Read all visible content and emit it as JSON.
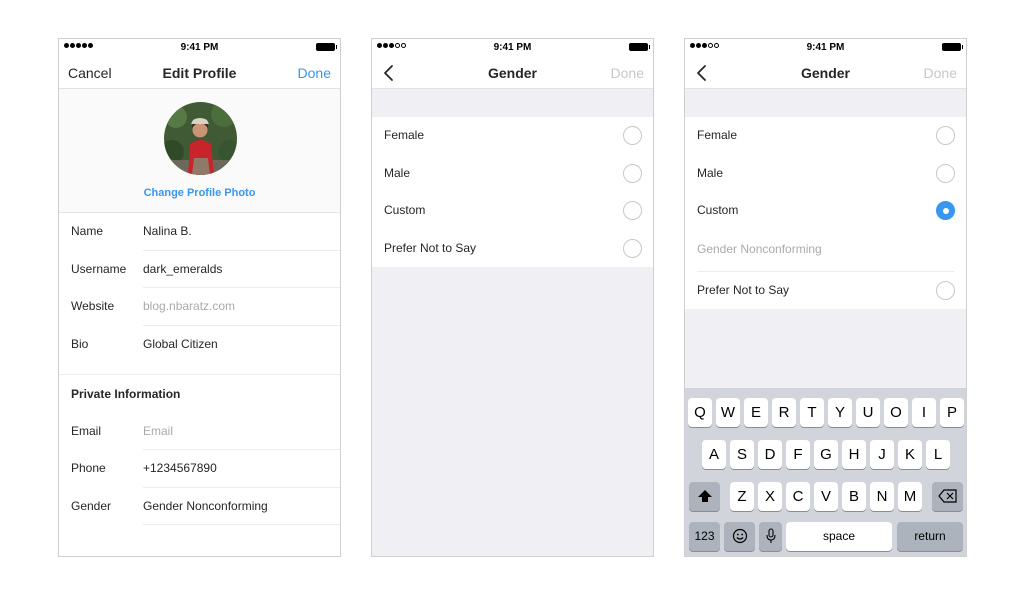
{
  "status_bar": {
    "time": "9:41 PM"
  },
  "edit_profile": {
    "nav": {
      "cancel": "Cancel",
      "title": "Edit Profile",
      "done": "Done"
    },
    "change_photo": "Change Profile Photo",
    "fields": [
      {
        "label": "Name",
        "value": "Nalina B."
      },
      {
        "label": "Username",
        "value": "dark_emeralds"
      },
      {
        "label": "Website",
        "placeholder": "blog.nbaratz.com"
      },
      {
        "label": "Bio",
        "value": "Global Citizen"
      }
    ],
    "private_header": "Private Information",
    "private_fields": [
      {
        "label": "Email",
        "placeholder": "Email"
      },
      {
        "label": "Phone",
        "value": "+1234567890"
      },
      {
        "label": "Gender",
        "value": "Gender Nonconforming"
      }
    ]
  },
  "gender_screen": {
    "nav": {
      "title": "Gender",
      "done": "Done"
    },
    "options": [
      "Female",
      "Male",
      "Custom",
      "Prefer Not to Say"
    ]
  },
  "gender_custom_screen": {
    "nav": {
      "title": "Gender",
      "done": "Done"
    },
    "options": [
      "Female",
      "Male",
      "Custom",
      "Prefer Not to Say"
    ],
    "selected": "Custom",
    "custom_placeholder": "Gender Nonconforming"
  },
  "keyboard": {
    "row1": [
      "Q",
      "W",
      "E",
      "R",
      "T",
      "Y",
      "U",
      "O",
      "I",
      "P"
    ],
    "row2": [
      "A",
      "S",
      "D",
      "F",
      "G",
      "H",
      "J",
      "K",
      "L"
    ],
    "row3": [
      "Z",
      "X",
      "C",
      "V",
      "B",
      "N",
      "M"
    ],
    "numbers_label": "123",
    "space_label": "space",
    "return_label": "return"
  },
  "colors": {
    "accent": "#3897f0",
    "disabled": "#c7c7c7",
    "keyboard_bg": "#d1d5db"
  },
  "icons": [
    "back-chevron-icon",
    "shift-icon",
    "delete-icon",
    "emoji-icon",
    "microphone-icon"
  ]
}
